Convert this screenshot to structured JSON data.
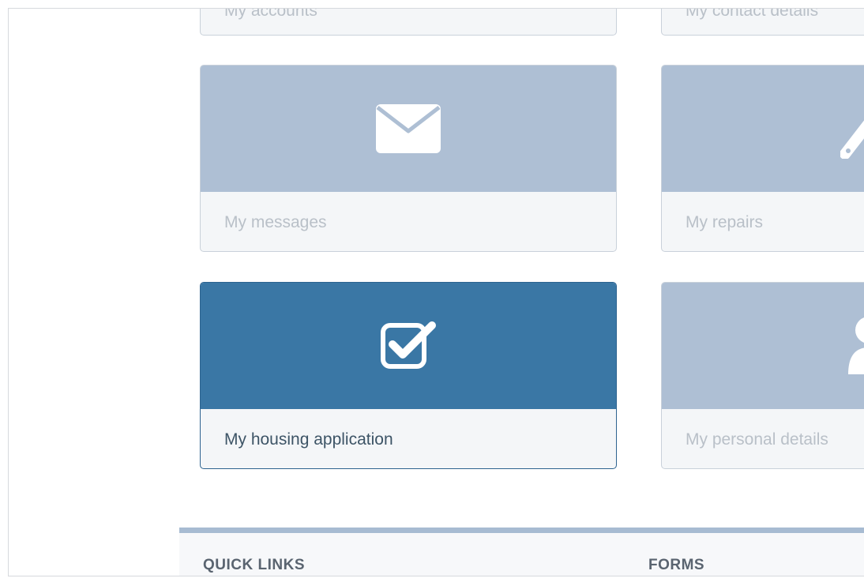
{
  "tiles": [
    {
      "label": "My accounts",
      "icon": "wallet-icon",
      "state": "default",
      "clipped": true
    },
    {
      "label": "My contact details",
      "icon": "phone-icon",
      "state": "default",
      "clipped": true
    },
    {
      "label": "My messages",
      "icon": "envelope-icon",
      "state": "default"
    },
    {
      "label": "My repairs",
      "icon": "wrench-icon",
      "state": "default"
    },
    {
      "label": "My housing application",
      "icon": "checkbox-icon",
      "state": "active"
    },
    {
      "label": "My personal details",
      "icon": "user-icon",
      "state": "default"
    }
  ],
  "quick_links": {
    "heading": "QUICK LINKS",
    "forms_heading": "FORMS"
  },
  "colors": {
    "tile_bg": "#aebfd4",
    "tile_active_bg": "#3a77a5",
    "tile_label": "#b9c0c8",
    "tile_active_label": "#3d5466"
  }
}
